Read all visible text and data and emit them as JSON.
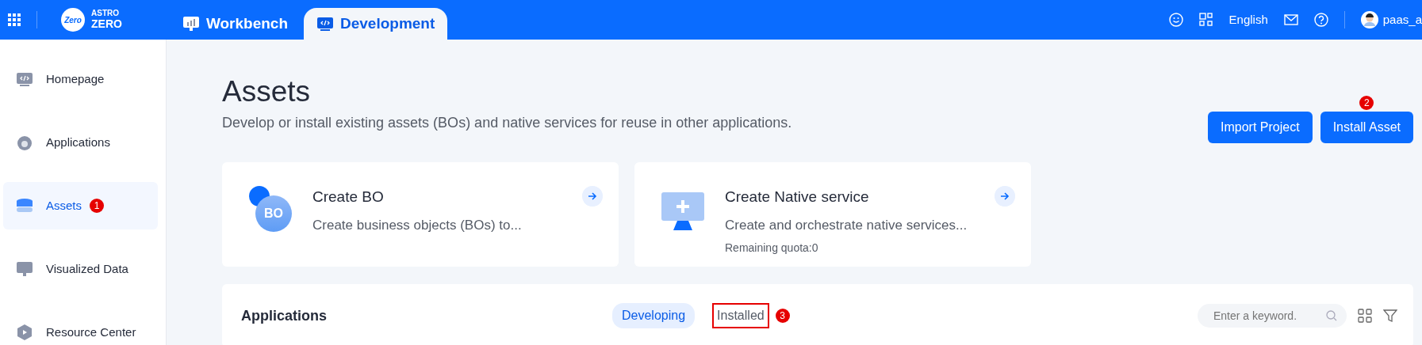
{
  "header": {
    "logo_top": "ASTRO",
    "logo_bottom": "ZERO",
    "logo_badge": "Zero",
    "tabs": [
      {
        "label": "Workbench",
        "selected": false,
        "kind": "chart"
      },
      {
        "label": "Development",
        "selected": true,
        "kind": "code"
      }
    ],
    "language": "English",
    "user": "paas_a"
  },
  "sidebar": {
    "items": [
      {
        "label": "Homepage",
        "selected": false,
        "kind": "code"
      },
      {
        "label": "Applications",
        "selected": false,
        "kind": "apps"
      },
      {
        "label": "Assets",
        "selected": true,
        "kind": "db",
        "marker": "1"
      },
      {
        "label": "Visualized Data",
        "selected": false,
        "kind": "chart"
      },
      {
        "label": "Resource Center",
        "selected": false,
        "kind": "box"
      }
    ]
  },
  "page": {
    "title": "Assets",
    "subtitle": "Develop or install existing assets (BOs) and native services for reuse in other applications.",
    "buttons": [
      {
        "label": "Import Project"
      },
      {
        "label": "Install Asset",
        "marker": "2"
      }
    ]
  },
  "cards": [
    {
      "kind": "bo",
      "icon_text": "BO",
      "title": "Create BO",
      "description": "Create business objects (BOs) to..."
    },
    {
      "kind": "native",
      "title": "Create Native service",
      "description": "Create and orchestrate native services...",
      "note": "Remaining quota:0"
    }
  ],
  "applications": {
    "title": "Applications",
    "tabs": [
      {
        "label": "Developing",
        "selected": true,
        "highlighted": false
      },
      {
        "label": "Installed",
        "selected": false,
        "highlighted": true,
        "marker": "3"
      }
    ],
    "search": {
      "placeholder": "Enter a keyword."
    }
  }
}
